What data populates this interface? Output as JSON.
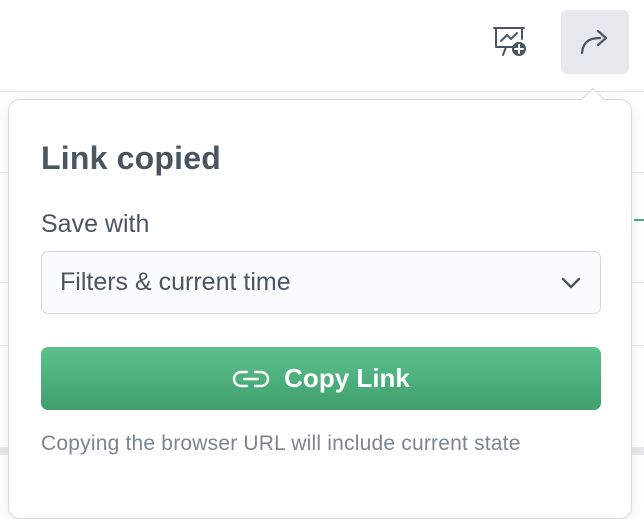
{
  "toolbar": {
    "present_icon": "presentation-add-icon",
    "share_icon": "share-arrow-icon"
  },
  "popover": {
    "title": "Link copied",
    "save_with_label": "Save with",
    "select": {
      "value": "Filters & current time",
      "icon": "chevron-down-icon"
    },
    "copy_button": {
      "label": "Copy Link",
      "icon": "link-icon",
      "color": "#4fb07d"
    },
    "hint": "Copying the browser URL will include current state"
  }
}
